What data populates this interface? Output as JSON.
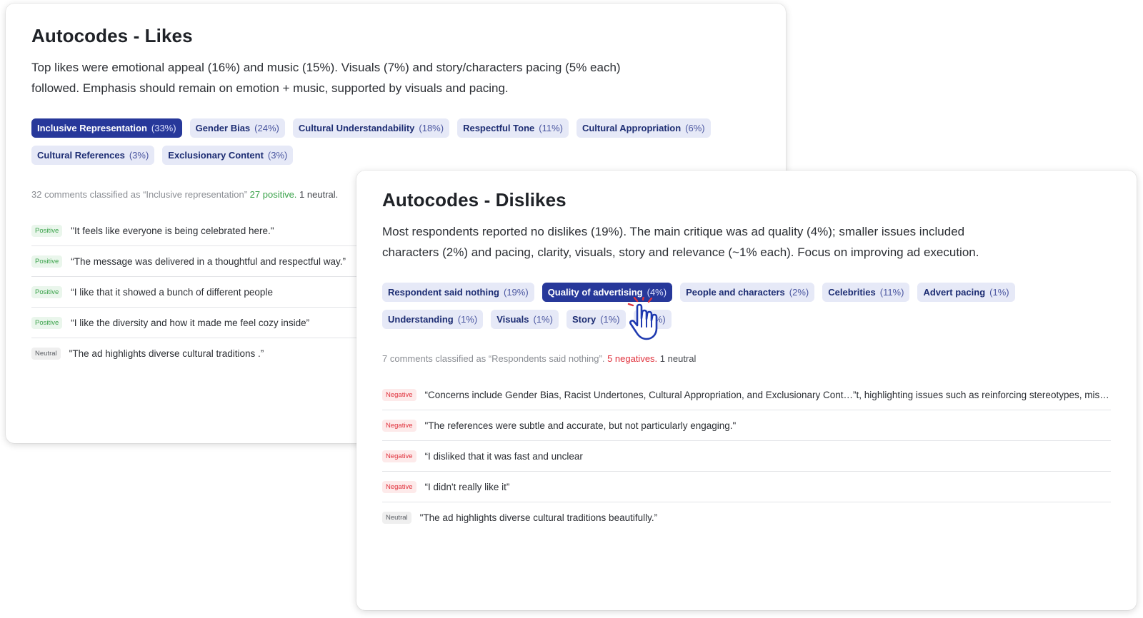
{
  "likes": {
    "title": "Autocodes - Likes",
    "description": "Top likes were emotional appeal (16%) and music (15%). Visuals (7%) and story/characters pacing (5% each) followed. Emphasis should remain on emotion + music, supported by visuals and pacing.",
    "tags": [
      {
        "label": "Inclusive Representation",
        "pct": "(33%)",
        "active": true
      },
      {
        "label": "Gender Bias",
        "pct": "(24%)"
      },
      {
        "label": "Cultural Understandability",
        "pct": "(18%)"
      },
      {
        "label": "Respectful Tone",
        "pct": "(11%)"
      },
      {
        "label": "Cultural Appropriation",
        "pct": "(6%)"
      },
      {
        "label": "Cultural References",
        "pct": "(3%)"
      },
      {
        "label": "Exclusionary Content",
        "pct": "(3%)"
      }
    ],
    "summary": {
      "prefix": "32 comments classified as “Inclusive representation”",
      "positive": "27 positive.",
      "neutral": "1 neutral."
    },
    "comments": [
      {
        "sentiment": "Positive",
        "text": "\"It feels like everyone is being celebrated here.\""
      },
      {
        "sentiment": "Positive",
        "text": "“The message was delivered in a thoughtful and respectful way.”"
      },
      {
        "sentiment": "Positive",
        "text": "“I like that it showed a bunch of different people"
      },
      {
        "sentiment": "Positive",
        "text": "“I like the diversity and how it made me feel cozy inside”"
      },
      {
        "sentiment": "Neutral",
        "text": "\"The ad highlights diverse cultural traditions .”"
      }
    ]
  },
  "dislikes": {
    "title": "Autocodes - Dislikes",
    "description": "Most respondents reported no dislikes (19%). The main critique was ad quality (4%); smaller issues included characters (2%) and pacing, clarity, visuals, story and relevance (~1% each). Focus on improving ad execution.",
    "tags": [
      {
        "label": "Respondent said nothing",
        "pct": "(19%)"
      },
      {
        "label": "Quality of advertising",
        "pct": "(4%)",
        "active": true
      },
      {
        "label": "People and characters",
        "pct": "(2%)"
      },
      {
        "label": "Celebrities",
        "pct": "(11%)"
      },
      {
        "label": "Advert pacing",
        "pct": "(1%)"
      },
      {
        "label": "Understanding",
        "pct": "(1%)"
      },
      {
        "label": "Visuals",
        "pct": "(1%)"
      },
      {
        "label": "Story",
        "pct": "(1%)"
      },
      {
        "label": "I",
        "pct": "(1%)"
      }
    ],
    "summary": {
      "prefix": "7 comments classified as “Respondents said nothing”.",
      "negative": "5 negatives.",
      "neutral": "1 neutral"
    },
    "comments": [
      {
        "sentiment": "Negative",
        "text": "“Concerns include Gender Bias, Racist Undertones, Cultural Appropriation, and Exclusionary Cont…”t, highlighting issues such as reinforcing stereotypes, misu…"
      },
      {
        "sentiment": "Negative",
        "text": "\"The references were subtle and accurate, but not particularly engaging.\""
      },
      {
        "sentiment": "Negative",
        "text": "“I disliked that it was fast and unclear"
      },
      {
        "sentiment": "Negative",
        "text": "“I didn't really like it”"
      },
      {
        "sentiment": "Neutral",
        "text": "\"The ad highlights diverse cultural traditions beautifully.”"
      }
    ]
  },
  "colors": {
    "accent": "#27389a",
    "tag_bg": "#e6e9f7",
    "positive": "#3aa24a",
    "negative": "#e0313c"
  },
  "icons": {
    "cursor": "hand-pointer-click-icon"
  }
}
